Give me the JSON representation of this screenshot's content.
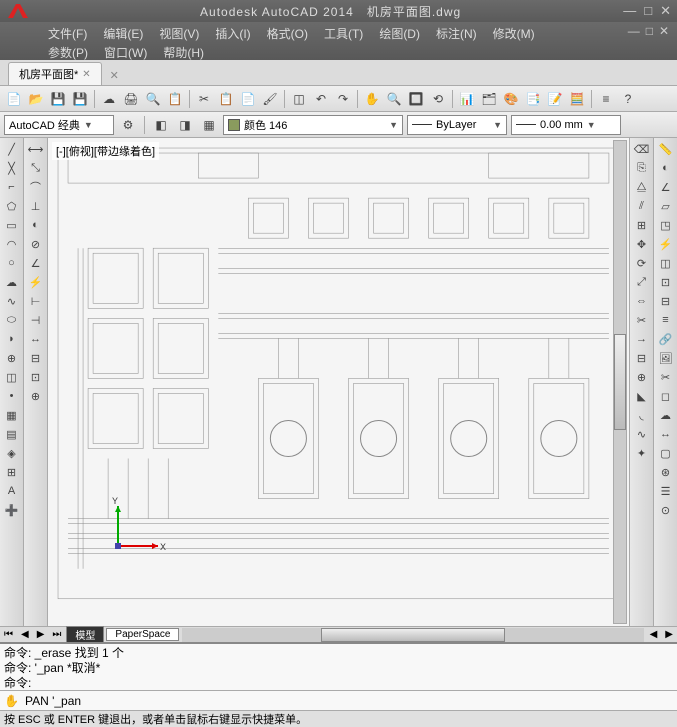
{
  "app": {
    "title": "Autodesk AutoCAD 2014",
    "filename": "机房平面图.dwg"
  },
  "menu": {
    "row1": [
      {
        "label": "文件(F)"
      },
      {
        "label": "编辑(E)"
      },
      {
        "label": "视图(V)"
      },
      {
        "label": "插入(I)"
      },
      {
        "label": "格式(O)"
      },
      {
        "label": "工具(T)"
      },
      {
        "label": "绘图(D)"
      },
      {
        "label": "标注(N)"
      },
      {
        "label": "修改(M)"
      }
    ],
    "row2": [
      {
        "label": "参数(P)"
      },
      {
        "label": "窗口(W)"
      },
      {
        "label": "帮助(H)"
      }
    ]
  },
  "tab": {
    "name": "机房平面图*",
    "star": ""
  },
  "workspace_combo": "AutoCAD 经典",
  "color_label": "颜色 146",
  "linetype": "ByLayer",
  "lineweight": "0.00 mm",
  "viewport_label": "[-][俯视][带边缘着色]",
  "model_tabs": {
    "model": "模型",
    "paper": "PaperSpace"
  },
  "cmd": {
    "line1": "命令: _erase 找到 1 个",
    "line2": "命令: '_pan *取消*",
    "line3": "命令:",
    "prompt_icon": "✋",
    "prompt": "PAN '_pan"
  },
  "status": "按 ESC 或 ENTER 键退出，或者单击鼠标右键显示快捷菜单。"
}
